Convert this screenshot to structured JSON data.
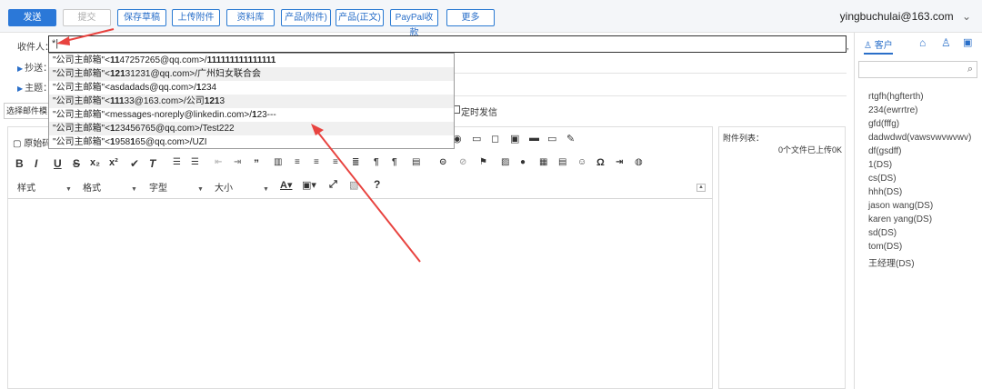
{
  "toolbar": {
    "send": "发送",
    "submit": "提交",
    "save_draft": "保存草稿",
    "upload": "上传附件",
    "library": "资料库",
    "product_attach": "产品(附件)",
    "product_body": "产品(正文)",
    "paypal": "PayPal收款",
    "more": "更多",
    "user_email": "yingbuchulai@163.com",
    "user_caret": "⌄"
  },
  "compose": {
    "to_label": "收件人：",
    "cc_label": "抄送：",
    "subject_label": "主题：",
    "to_value": "*|",
    "template_label": "选择邮件模",
    "schedule_label": "定时发信",
    "original_label": "原始码"
  },
  "dropdown": [
    {
      "prefix": "\"公司主邮箱\"<",
      "bold": "11",
      "mid": "47257265@qq.com>/",
      "bold2": "111111111111111",
      "tail": ""
    },
    {
      "prefix": "\"公司主邮箱\"<",
      "bold": "121",
      "mid": "31231@qq.com>/广州妇女联合会",
      "bold2": "",
      "tail": ""
    },
    {
      "prefix": "\"公司主邮箱\"<asdadads@qq.com>/",
      "bold": "1",
      "mid": "234",
      "bold2": "",
      "tail": ""
    },
    {
      "prefix": "\"公司主邮箱\"<",
      "bold": "111",
      "mid": "33@163.com>/公司",
      "bold2": "121",
      "tail": "3"
    },
    {
      "prefix": "\"公司主邮箱\"<messages-noreply@linkedin.com>/",
      "bold": "1",
      "mid": "23---",
      "bold2": "",
      "tail": ""
    },
    {
      "prefix": "\"公司主邮箱\"<",
      "bold": "1",
      "mid": "23456765@qq.com>/Test222",
      "bold2": "",
      "tail": ""
    },
    {
      "prefix": "\"公司主邮箱\"<",
      "bold": "1",
      "mid": "958",
      "bold2": "1",
      "tail": "65@qq.com>/UZI"
    }
  ],
  "editor": {
    "style_label": "样式",
    "format_label": "格式",
    "font_label": "字型",
    "size_label": "大小",
    "help": "?"
  },
  "attachments": {
    "title": "附件列表：",
    "status": "0个文件已上传0K"
  },
  "side": {
    "tab_customer": "客户",
    "contacts": [
      "rtgfh(hgfterth)",
      "234(ewrrtre)",
      "gfd(fffg)",
      "dadwdwd(vawsvwvwvwv)",
      "df(gsdff)",
      "1(DS)",
      "cs(DS)",
      "hhh(DS)",
      "jason wang(DS)",
      "karen yang(DS)",
      "sd(DS)",
      "tom(DS)",
      "王经理(DS)"
    ]
  },
  "colors": {
    "accent": "#2b78d8",
    "arrow": "#e8433f"
  }
}
